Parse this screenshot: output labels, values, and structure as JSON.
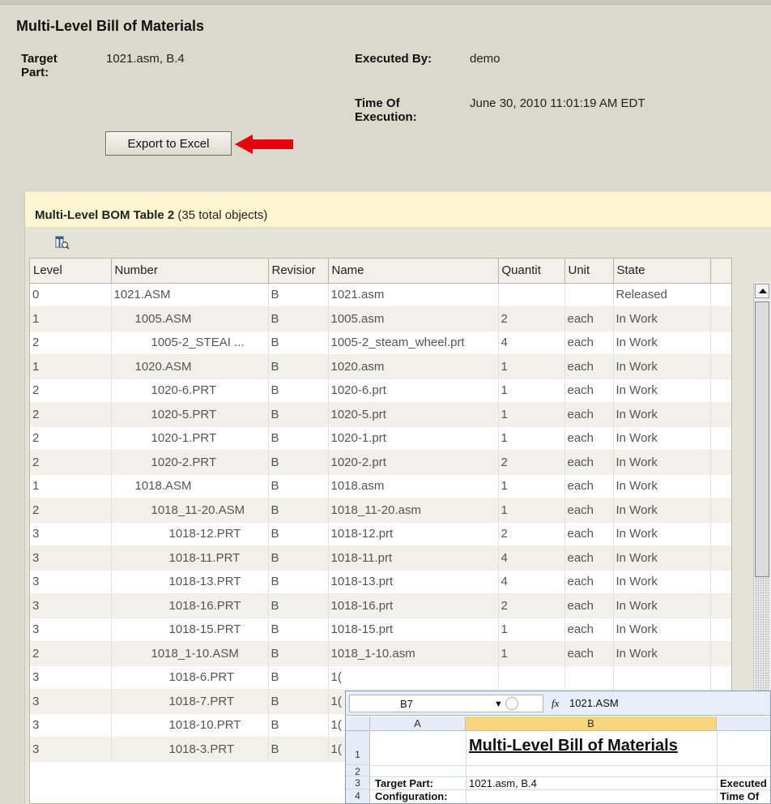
{
  "header": {
    "title": "Multi-Level Bill of Materials",
    "target_part_label": "Target Part:",
    "target_part_value": "1021.asm, B.4",
    "executed_by_label": "Executed By:",
    "executed_by_value": "demo",
    "time_label": "Time Of Execution:",
    "time_value": "June 30, 2010 11:01:19 AM EDT"
  },
  "export_button": "Export to Excel",
  "arrow_color": "#e8000f",
  "table_panel": {
    "title_bold": "Multi-Level BOM Table 2",
    "title_count": "(35 total objects)",
    "columns_icon": "column-chooser-icon",
    "columns": [
      "Level",
      "Number",
      "Revisior",
      "Name",
      "Quantit",
      "Unit",
      "State"
    ],
    "rows": [
      [
        "0",
        "1021.ASM",
        "B",
        "1021.asm",
        "",
        "",
        "Released"
      ],
      [
        "1",
        "1005.ASM",
        "B",
        "1005.asm",
        "2",
        "each",
        "In Work"
      ],
      [
        "2",
        "1005-2_STEAI ...",
        "B",
        "1005-2_steam_wheel.prt",
        "4",
        "each",
        "In Work"
      ],
      [
        "1",
        "1020.ASM",
        "B",
        "1020.asm",
        "1",
        "each",
        "In Work"
      ],
      [
        "2",
        "1020-6.PRT",
        "B",
        "1020-6.prt",
        "1",
        "each",
        "In Work"
      ],
      [
        "2",
        "1020-5.PRT",
        "B",
        "1020-5.prt",
        "1",
        "each",
        "In Work"
      ],
      [
        "2",
        "1020-1.PRT",
        "B",
        "1020-1.prt",
        "1",
        "each",
        "In Work"
      ],
      [
        "2",
        "1020-2.PRT",
        "B",
        "1020-2.prt",
        "2",
        "each",
        "In Work"
      ],
      [
        "1",
        "1018.ASM",
        "B",
        "1018.asm",
        "1",
        "each",
        "In Work"
      ],
      [
        "2",
        "1018_11-20.ASM",
        "B",
        "1018_11-20.asm",
        "1",
        "each",
        "In Work"
      ],
      [
        "3",
        "1018-12.PRT",
        "B",
        "1018-12.prt",
        "2",
        "each",
        "In Work"
      ],
      [
        "3",
        "1018-11.PRT",
        "B",
        "1018-11.prt",
        "4",
        "each",
        "In Work"
      ],
      [
        "3",
        "1018-13.PRT",
        "B",
        "1018-13.prt",
        "4",
        "each",
        "In Work"
      ],
      [
        "3",
        "1018-16.PRT",
        "B",
        "1018-16.prt",
        "2",
        "each",
        "In Work"
      ],
      [
        "3",
        "1018-15.PRT",
        "B",
        "1018-15.prt",
        "1",
        "each",
        "In Work"
      ],
      [
        "2",
        "1018_1-10.ASM",
        "B",
        "1018_1-10.asm",
        "1",
        "each",
        "In Work"
      ],
      [
        "3",
        "1018-6.PRT",
        "B",
        "1(",
        "",
        "",
        ""
      ],
      [
        "3",
        "1018-7.PRT",
        "B",
        "1(",
        "",
        "",
        ""
      ],
      [
        "3",
        "1018-10.PRT",
        "B",
        "1(",
        "",
        "",
        ""
      ],
      [
        "3",
        "1018-3.PRT",
        "B",
        "1(",
        "",
        "",
        ""
      ]
    ]
  },
  "excel": {
    "name_box": "B7",
    "fx_symbol": "fx",
    "formula_value": "1021.ASM",
    "col_a": "A",
    "col_b": "B",
    "row_numbers": [
      "1",
      "2",
      "3",
      "4"
    ],
    "title": "Multi-Level Bill of Materials",
    "a3": "Target Part:",
    "b3": "1021.asm, B.4",
    "c3": "Executed",
    "a4": "Configuration:",
    "c4": "Time Of"
  }
}
